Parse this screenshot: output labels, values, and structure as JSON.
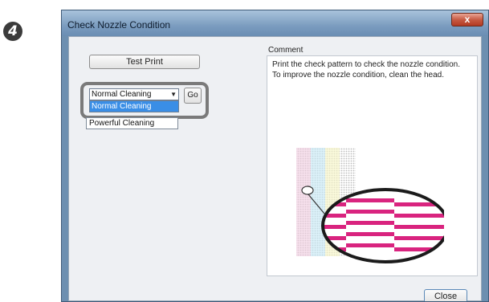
{
  "step": "4",
  "window": {
    "title": "Check Nozzle Condition",
    "close_glyph": "x"
  },
  "test_print_label": "Test Print",
  "cleaning": {
    "selected": "Normal Cleaning",
    "options": [
      "Normal Cleaning",
      "Powerful Cleaning"
    ],
    "go_label": "Go"
  },
  "comment": {
    "label": "Comment",
    "lines": [
      "Print the check pattern to check the nozzle condition.",
      "To improve the nozzle condition, clean the head."
    ]
  },
  "close_label": "Close",
  "pattern_colors": {
    "magenta": "#d9247f",
    "cyan": "#7fd0ea",
    "yellow": "#f1ec96",
    "black": "#777777"
  }
}
